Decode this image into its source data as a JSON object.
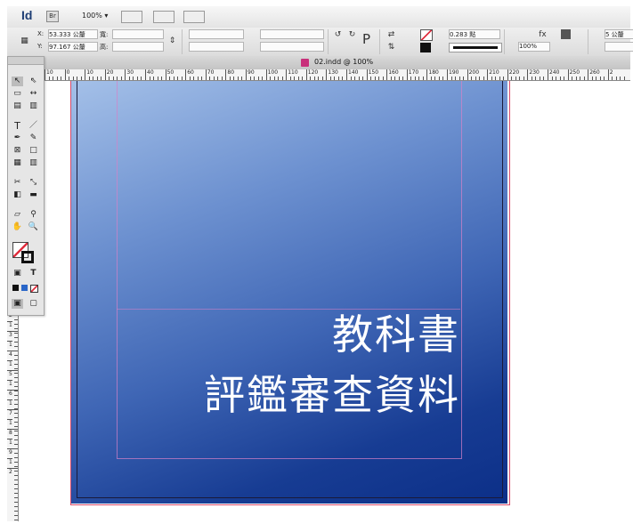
{
  "app": {
    "logo": "Id",
    "bridge": "Br",
    "zoom": "100%"
  },
  "control": {
    "x_label": "X:",
    "x_value": "53.333 公釐",
    "y_label": "Y:",
    "y_value": "97.167 公釐",
    "w_label": "寬:",
    "h_label": "高:",
    "stroke_weight": "0.283 點",
    "opacity": "100%",
    "gap_value": "5 公釐"
  },
  "document": {
    "tab_title": "02.indd @ 100%"
  },
  "ruler": {
    "h_labels": [
      "10",
      "0",
      "10",
      "20",
      "30",
      "40",
      "50",
      "60",
      "70",
      "80",
      "90",
      "100",
      "110",
      "120",
      "130",
      "140",
      "150",
      "160",
      "170",
      "180",
      "190",
      "200",
      "210",
      "220",
      "230",
      "240",
      "250",
      "260",
      "2"
    ],
    "v_labels": [
      "2",
      "1",
      "3",
      "1",
      "4",
      "1",
      "5",
      "1",
      "6",
      "1",
      "7",
      "1",
      "8",
      "1",
      "9",
      "1",
      "2"
    ]
  },
  "canvas": {
    "title_line1": "教科書",
    "title_line2": "評鑑審查資料"
  },
  "colors": {
    "page_light": "#a4c0e8",
    "page_dark": "#0c2f88",
    "bleed": "#d94b6a"
  }
}
